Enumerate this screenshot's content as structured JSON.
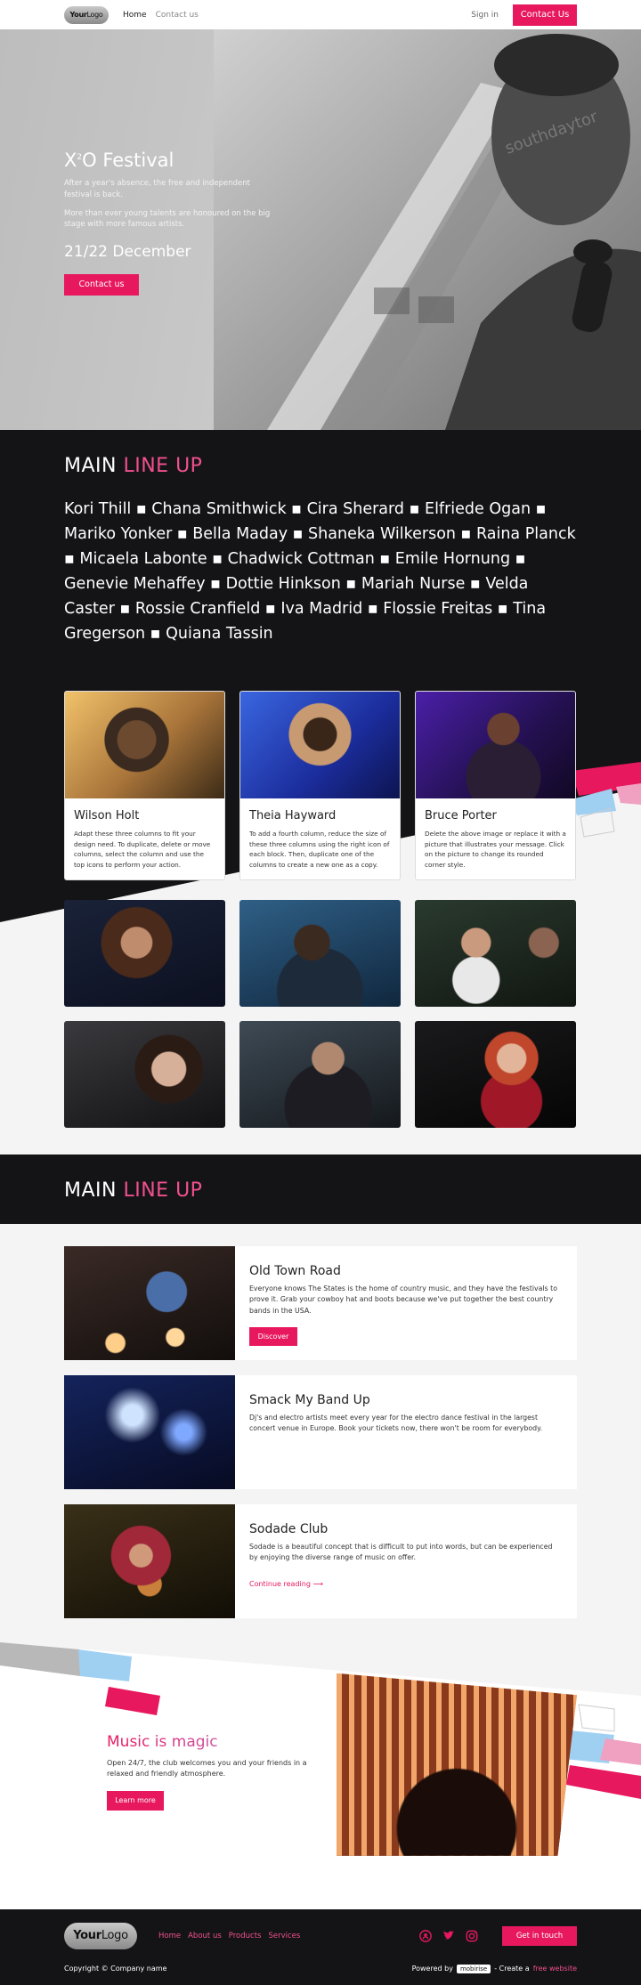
{
  "nav": {
    "logo_bold": "Your",
    "logo_light": "Logo",
    "links": [
      "Home",
      "Contact us"
    ],
    "signin": "Sign in",
    "cta": "Contact Us"
  },
  "hero": {
    "title_main": "X",
    "title_sup": "2",
    "title_rest": "O Festival",
    "text1": "After a year's absence, the free and independent festival is back.",
    "text2": "More than ever young talents are honoured on the big stage with more famous artists.",
    "date": "21/22 December",
    "cta": "Contact us",
    "banner_text": "southdaytor"
  },
  "lineup": {
    "title_a": "MAIN ",
    "title_b": "LINE UP",
    "names": "Kori Thill ▪ Chana Smithwick ▪ Cira Sherard ▪ Elfriede Ogan ▪ Mariko Yonker ▪ Bella Maday ▪ Shaneka Wilkerson ▪ Raina Planck ▪ Micaela Labonte ▪ Chadwick Cottman ▪ Emile Hornung ▪ Genevie Mehaffey ▪ Dottie Hinkson ▪ Mariah Nurse ▪ Velda Caster ▪ Rossie Cranfield ▪ Iva Madrid ▪ Flossie Freitas ▪ Tina Gregerson ▪ Quiana Tassin"
  },
  "cards": [
    {
      "name": "Wilson Holt",
      "text": "Adapt these three columns to fit your design need. To duplicate, delete or move columns, select the column and use the top icons to perform your action."
    },
    {
      "name": "Theia Hayward",
      "text": "To add a fourth column, reduce the size of these three columns using the right icon of each block. Then, duplicate one of the columns to create a new one as a copy."
    },
    {
      "name": "Bruce Porter",
      "text": "Delete the above image or replace it with a picture that illustrates your message. Click on the picture to change its rounded corner style."
    }
  ],
  "lineup2": {
    "title_a": "MAIN ",
    "title_b": "LINE UP"
  },
  "events": [
    {
      "title": "Old Town Road",
      "text": "Everyone knows The States is the home of country music, and they have the festivals to prove it. Grab your cowboy hat and boots because we've put together the best country bands in the USA.",
      "cta": "Discover"
    },
    {
      "title": "Smack My Band Up",
      "text": "Dj's and electro artists meet every year for the electro dance festival in the largest concert venue in Europe. Book your tickets now, there won't be room for everybody."
    },
    {
      "title": "Sodade Club",
      "text": "Sodade is a beautiful concept that is difficult to put into words, but can be experienced by enjoying the diverse range of music on offer.",
      "link": "Continue reading",
      "link_arrow": "⟶"
    }
  ],
  "magic": {
    "title": "Music is magic",
    "text": "Open 24/7, the club welcomes you and your friends in a relaxed and friendly atmosphere.",
    "cta": "Learn more"
  },
  "footer": {
    "logo_bold": "Your",
    "logo_light": "Logo",
    "links": [
      "Home",
      "About us",
      "Products",
      "Services"
    ],
    "cta": "Get in touch",
    "copyright": "Copyright © Company name",
    "powered": "Powered by",
    "powered_badge": "mobirise",
    "create": "- Create a",
    "free": "free website"
  },
  "colors": {
    "accent": "#e8185f",
    "dark": "#141416",
    "light_bg": "#f4f4f5",
    "blue_accent": "#9fd0f2"
  }
}
